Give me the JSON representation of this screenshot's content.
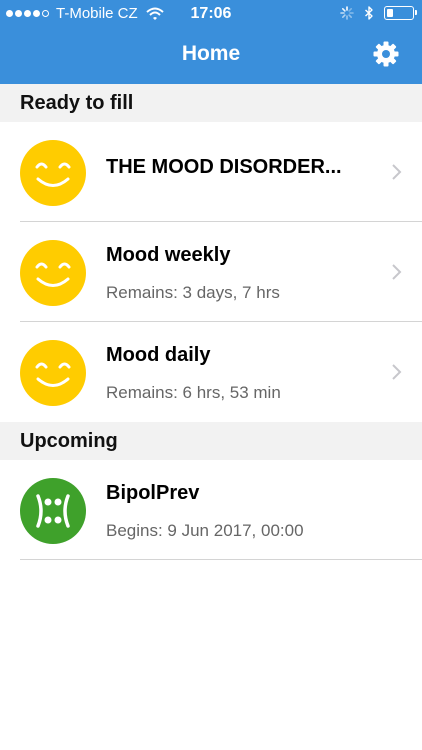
{
  "status_bar": {
    "carrier": "T-Mobile CZ",
    "time": "17:06",
    "signal_bars": 4,
    "signal_max": 5,
    "battery_level": 0.25
  },
  "navbar": {
    "title": "Home",
    "settings_icon": "gear-icon"
  },
  "sections": {
    "ready": {
      "header": "Ready to fill",
      "items": [
        {
          "title": "THE MOOD DISORDER...",
          "subtitle": "",
          "icon": "smiley-face-icon"
        },
        {
          "title": "Mood weekly",
          "subtitle": "Remains: 3 days, 7 hrs",
          "icon": "smiley-face-icon"
        },
        {
          "title": "Mood daily",
          "subtitle": "Remains: 6 hrs, 53 min",
          "icon": "smiley-face-icon"
        }
      ]
    },
    "upcoming": {
      "header": "Upcoming",
      "items": [
        {
          "title": "BipolPrev",
          "subtitle": "Begins: 9 Jun 2017, 00:00",
          "icon": "bipolar-face-icon"
        }
      ]
    }
  },
  "colors": {
    "primary": "#3a8fdb",
    "smiley_yellow": "#ffcc00",
    "bipolar_green": "#3fa12b",
    "section_bg": "#f2f2f2"
  }
}
